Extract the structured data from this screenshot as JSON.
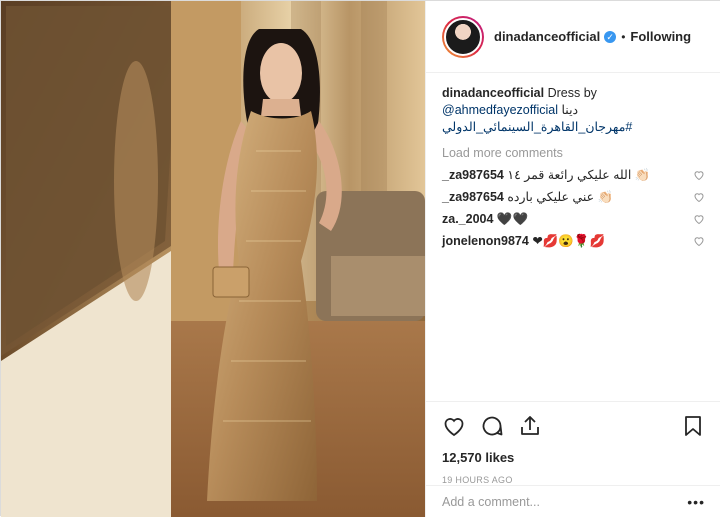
{
  "post": {
    "username": "dinadanceofficial",
    "follow_label": "Following",
    "caption": {
      "username": "dinadanceofficial",
      "text": "Dress by",
      "mention": "@ahmedfayezofficial",
      "arabic_name": "دينا",
      "hashtag": "#مهرجان_القاهرة_السينمائي_الدولي"
    },
    "load_more": "Load more comments",
    "comments": [
      {
        "username": "_za987654",
        "text": "الله عليكي رائعة قمر ١٤ 👏🏻"
      },
      {
        "username": "_za987654",
        "text": "عني عليكي بارده 👏🏻"
      },
      {
        "username": "za._2004",
        "text": "🖤🖤"
      },
      {
        "username": "jonelenon9874",
        "text": "❤💋😮🌹💋"
      }
    ],
    "likes": "12,570 likes",
    "timestamp": "19 HOURS AGO",
    "comment_placeholder": "Add a comment..."
  },
  "icons": {
    "like": "heart-icon",
    "comment": "comment-icon",
    "share": "share-icon",
    "save": "bookmark-icon",
    "verified": "verified-badge-icon",
    "more": "more-options-icon"
  },
  "colors": {
    "link": "#003569",
    "verified": "#3897f0",
    "muted": "#999999"
  }
}
